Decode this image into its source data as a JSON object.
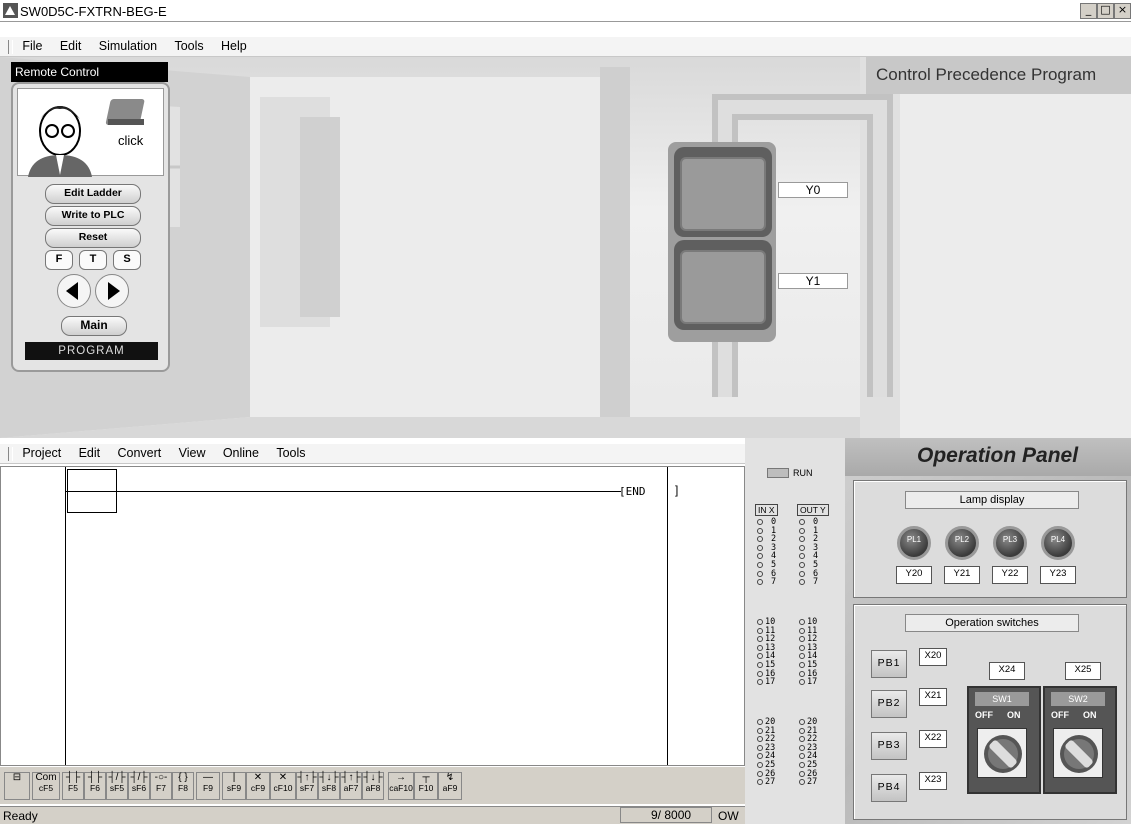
{
  "window": {
    "title": "SW0D5C-FXTRN-BEG-E",
    "controls": [
      "_",
      "□",
      "×"
    ]
  },
  "app_menu": [
    "File",
    "Edit",
    "Simulation",
    "Tools",
    "Help"
  ],
  "remote": {
    "tab_label": "Remote Control",
    "bubble_text": "click",
    "buttons": {
      "edit_ladder": "Edit Ladder",
      "write_plc": "Write to PLC",
      "reset": "Reset",
      "main": "Main"
    },
    "fts": [
      "F",
      "T",
      "S"
    ],
    "mode_label": "PROGRAM"
  },
  "scene": {
    "precedence_label": "Control Precedence Program",
    "lamp_labels": [
      "Y0",
      "Y1"
    ]
  },
  "editor_menu": [
    "Project",
    "Edit",
    "Convert",
    "View",
    "Online",
    "Tools"
  ],
  "ladder": {
    "end_label": "[END"
  },
  "toolbar": {
    "buttons": [
      {
        "top": "⊟",
        "bottom": ""
      },
      {
        "top": "Com",
        "bottom": "cF5"
      },
      {
        "top": "┤├",
        "bottom": "F5"
      },
      {
        "top": "┤├",
        "bottom": "F6"
      },
      {
        "top": "┤/├",
        "bottom": "sF5"
      },
      {
        "top": "┤/├",
        "bottom": "sF6"
      },
      {
        "top": "-○-",
        "bottom": "F7"
      },
      {
        "top": "{ }",
        "bottom": "F8"
      },
      {
        "top": "—",
        "bottom": "F9"
      },
      {
        "top": "|",
        "bottom": "sF9"
      },
      {
        "top": "✕",
        "bottom": "cF9"
      },
      {
        "top": "✕",
        "bottom": "cF10"
      },
      {
        "top": "┤↑├",
        "bottom": "sF7"
      },
      {
        "top": "┤↓├",
        "bottom": "sF8"
      },
      {
        "top": "┤↑├",
        "bottom": "aF7"
      },
      {
        "top": "┤↓├",
        "bottom": "aF8"
      },
      {
        "top": "→",
        "bottom": "caF10"
      },
      {
        "top": "┬",
        "bottom": "F10"
      },
      {
        "top": "↯",
        "bottom": "aF9"
      }
    ]
  },
  "status": {
    "left": "Ready",
    "steps": "9/ 8000",
    "mode": "OW"
  },
  "io": {
    "run_label": "RUN",
    "in_header": "IN X",
    "out_header": "OUT Y",
    "groups": [
      [
        "0",
        "1",
        "2",
        "3",
        "4",
        "5",
        "6",
        "7"
      ],
      [
        "10",
        "11",
        "12",
        "13",
        "14",
        "15",
        "16",
        "17"
      ],
      [
        "20",
        "21",
        "22",
        "23",
        "24",
        "25",
        "26",
        "27"
      ]
    ]
  },
  "operation_panel": {
    "title": "Operation Panel",
    "lamp_display_label": "Lamp display",
    "lamps": [
      {
        "label": "PL1",
        "address": "Y20"
      },
      {
        "label": "PL2",
        "address": "Y21"
      },
      {
        "label": "PL3",
        "address": "Y22"
      },
      {
        "label": "PL4",
        "address": "Y23"
      }
    ],
    "switches_label": "Operation switches",
    "push_buttons": [
      {
        "label": "PB1",
        "address": "X20"
      },
      {
        "label": "PB2",
        "address": "X21"
      },
      {
        "label": "PB3",
        "address": "X22"
      },
      {
        "label": "PB4",
        "address": "X23"
      }
    ],
    "selectors": [
      {
        "label": "SW1",
        "address": "X24",
        "off": "OFF",
        "on": "ON"
      },
      {
        "label": "SW2",
        "address": "X25",
        "off": "OFF",
        "on": "ON"
      }
    ]
  },
  "colors": {
    "title_bg": "#ffffff",
    "panel_bg": "#c8c8c8",
    "toolbar_bg": "#d4d0c8",
    "remote_tab": "#000000"
  }
}
